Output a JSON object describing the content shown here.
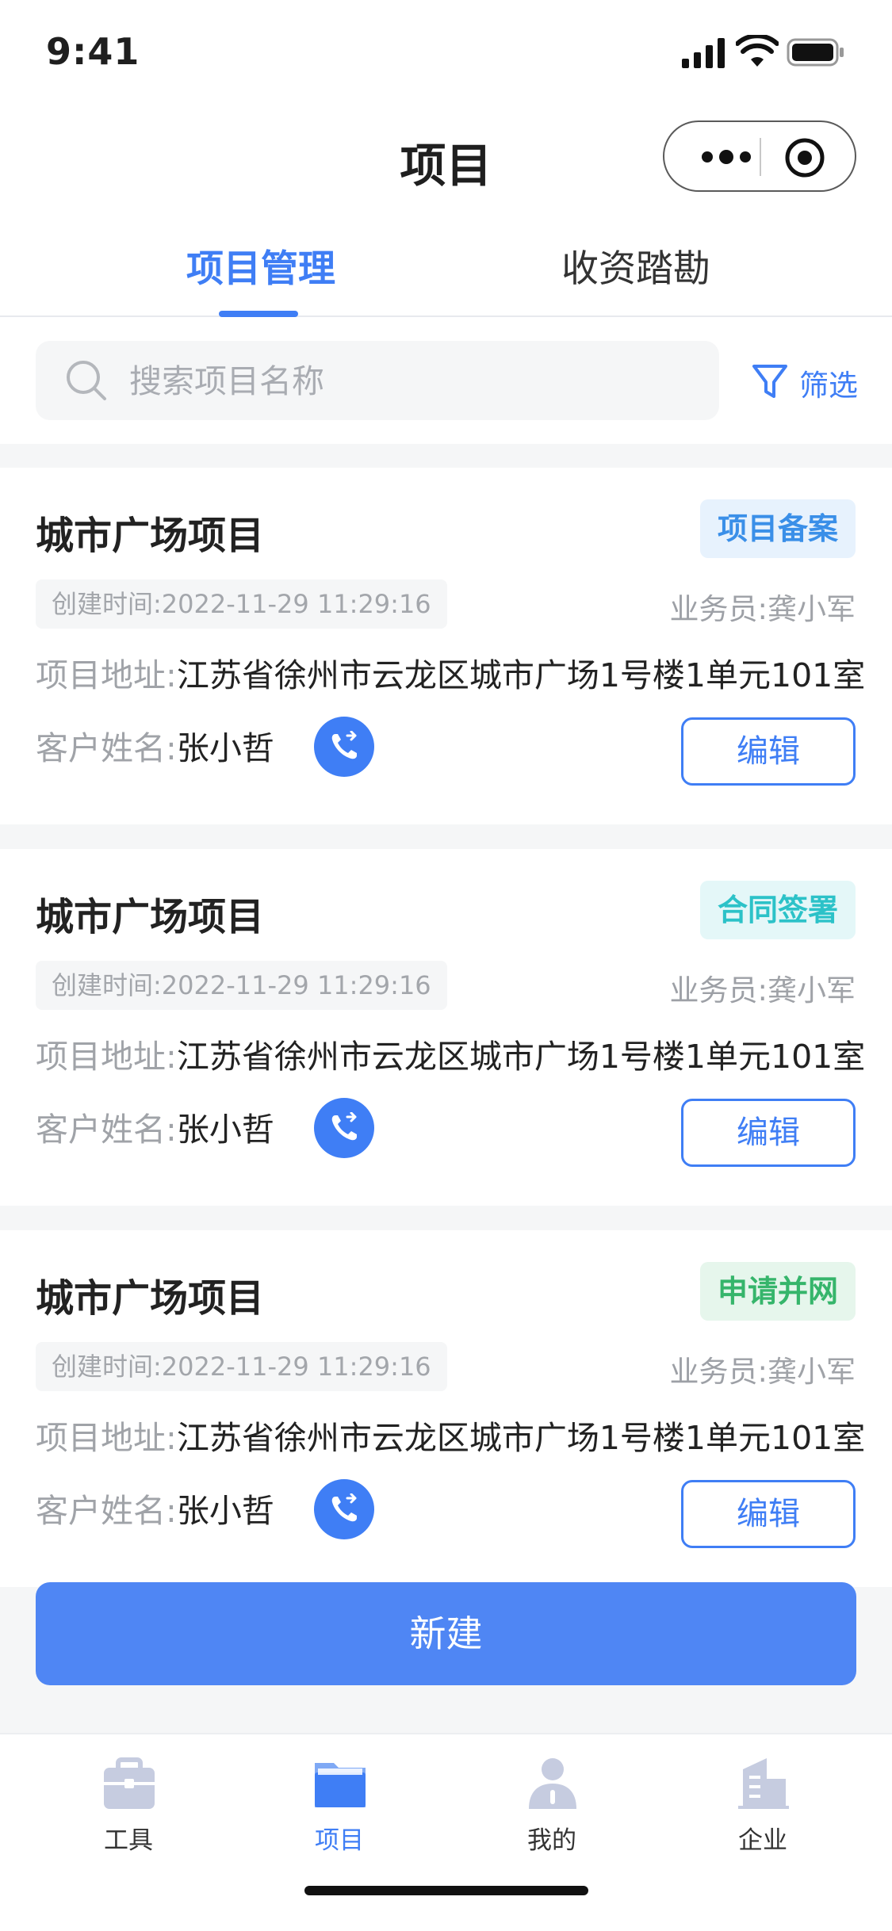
{
  "status_bar": {
    "time": "9:41"
  },
  "nav": {
    "title": "项目"
  },
  "tabs": [
    {
      "label": "项目管理",
      "active": true
    },
    {
      "label": "收资踏勘",
      "active": false
    }
  ],
  "search": {
    "placeholder": "搜索项目名称",
    "filter_label": "筛选"
  },
  "projects": [
    {
      "name": "城市广场项目",
      "status": "项目备案",
      "status_color": "#3a8fe8",
      "created_label": "创建时间:",
      "created_value": "2022-11-29 11:29:16",
      "staff_label": "业务员:",
      "staff_value": "龚小军",
      "address_label": "项目地址:",
      "address_value": "江苏省徐州市云龙区城市广场1号楼1单元101室",
      "customer_label": "客户姓名:",
      "customer_value": "张小哲",
      "edit_label": "编辑"
    },
    {
      "name": "城市广场项目",
      "status": "合同签署",
      "status_color": "#2cc2c8",
      "created_label": "创建时间:",
      "created_value": "2022-11-29 11:29:16",
      "staff_label": "业务员:",
      "staff_value": "龚小军",
      "address_label": "项目地址:",
      "address_value": "江苏省徐州市云龙区城市广场1号楼1单元101室",
      "customer_label": "客户姓名:",
      "customer_value": "张小哲",
      "edit_label": "编辑"
    },
    {
      "name": "城市广场项目",
      "status": "申请并网",
      "status_color": "#36b56b",
      "created_label": "创建时间:",
      "created_value": "2022-11-29 11:29:16",
      "staff_label": "业务员:",
      "staff_value": "龚小军",
      "address_label": "项目地址:",
      "address_value": "江苏省徐州市云龙区城市广场1号楼1单元101室",
      "customer_label": "客户姓名:",
      "customer_value": "张小哲",
      "edit_label": "编辑"
    }
  ],
  "create_button": "新建",
  "tabbar": [
    {
      "label": "工具",
      "icon": "toolbox-icon",
      "active": false
    },
    {
      "label": "项目",
      "icon": "folder-icon",
      "active": true
    },
    {
      "label": "我的",
      "icon": "person-icon",
      "active": false
    },
    {
      "label": "企业",
      "icon": "building-icon",
      "active": false
    }
  ],
  "colors": {
    "primary": "#3f7ef5",
    "create_button": "#4f86f4",
    "tabbar_inactive": "#c6cce0"
  }
}
